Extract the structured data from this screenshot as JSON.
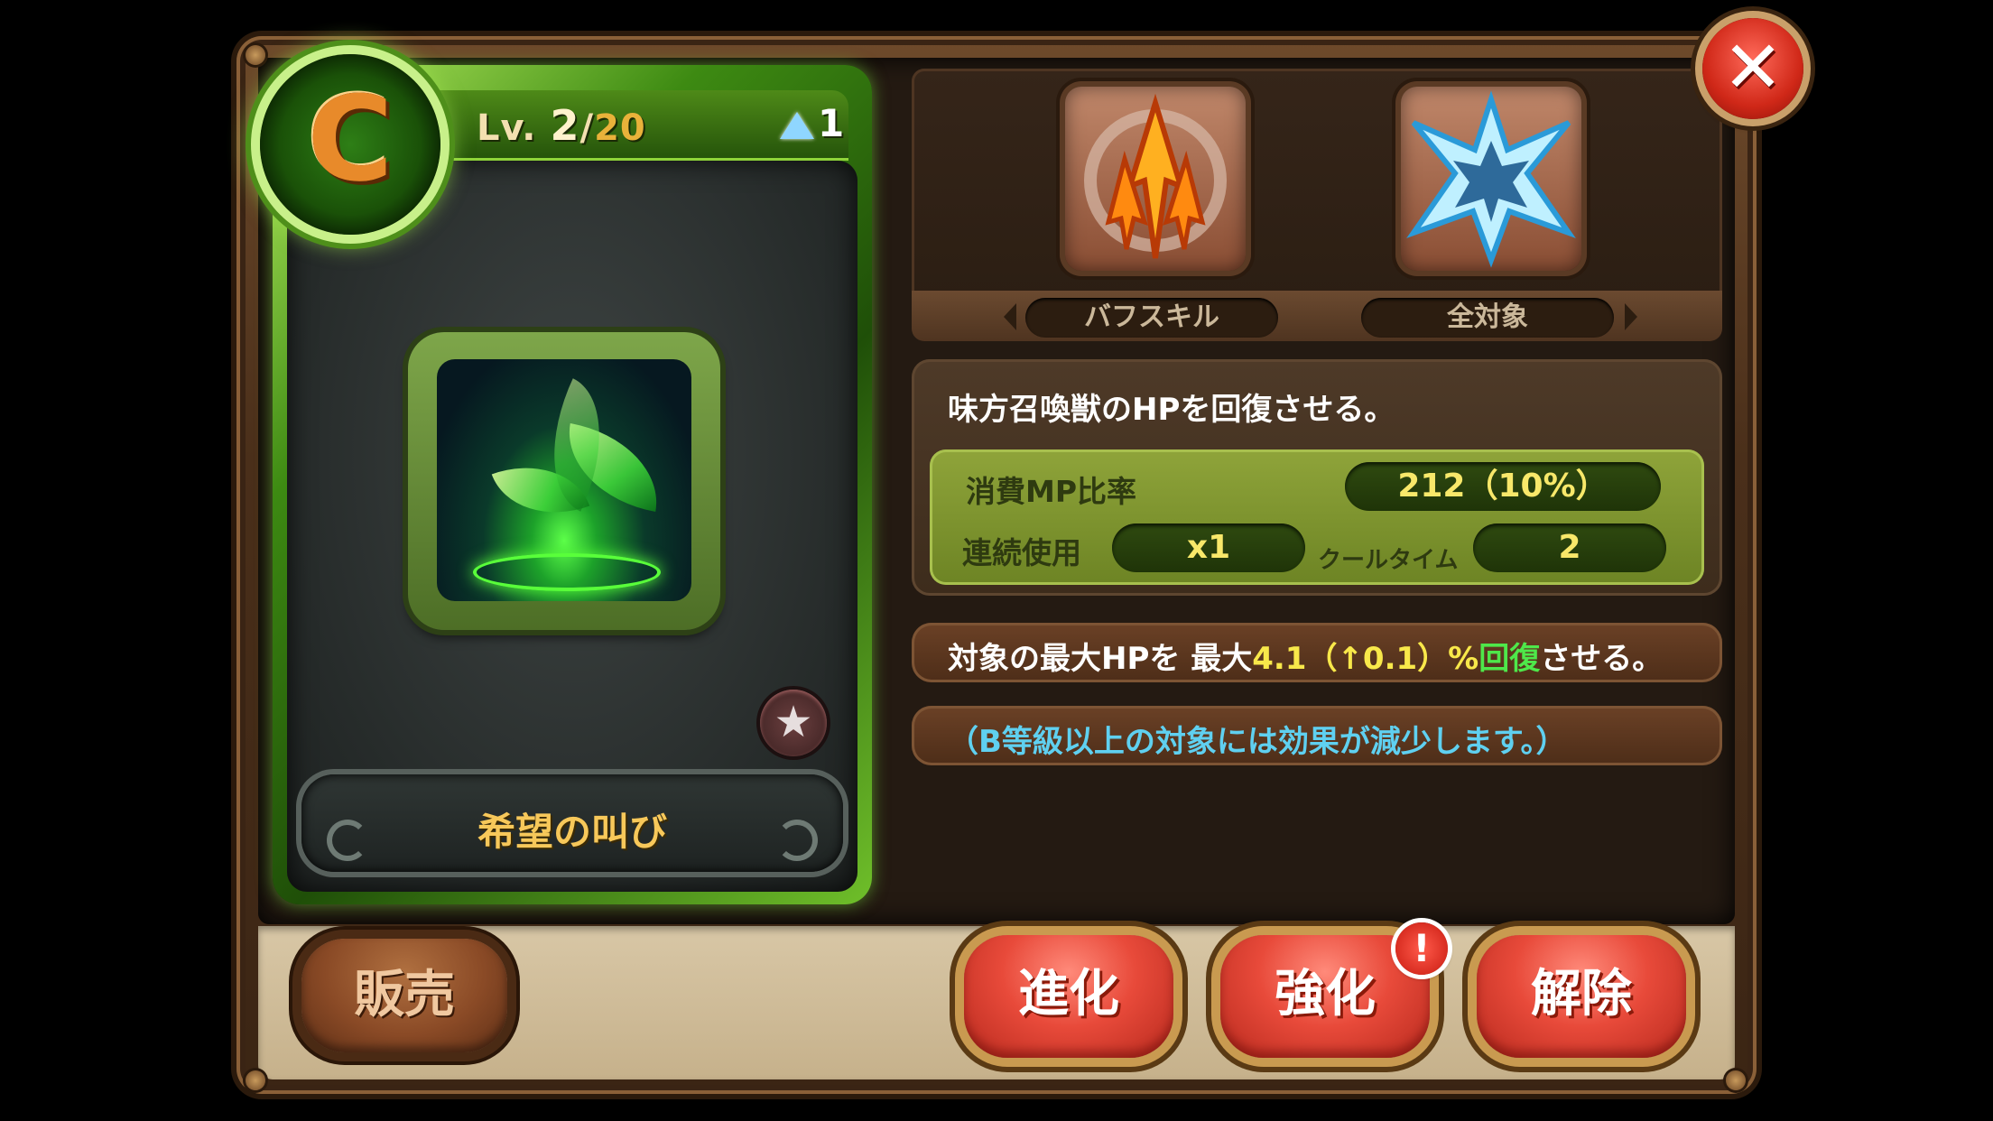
{
  "card": {
    "grade": "C",
    "level_prefix": "Lv.",
    "level_current": "2",
    "level_separator": "/",
    "level_max": "20",
    "awakening_count": "1",
    "skill_name": "希望の叫び"
  },
  "skill_tabs": {
    "type_label": "バフスキル",
    "target_label": "全対象"
  },
  "description": {
    "summary": "味方召喚獣のHPを回復させる。",
    "mp_label": "消費MP比率",
    "mp_value": "212（10%）",
    "combo_label": "連続使用",
    "combo_value": "x1",
    "cooldown_label": "クールタイム",
    "cooldown_value": "2"
  },
  "effect": {
    "prefix": "対象の最大HPを 最大",
    "amount": "4.1（↑0.1）",
    "percent": "%",
    "heal_word": "回復",
    "suffix": "させる。",
    "note": "（B等級以上の対象には効果が減少します。）"
  },
  "buttons": {
    "sell": "販売",
    "evolve": "進化",
    "enhance": "強化",
    "release": "解除",
    "alert": "!",
    "close": "✕",
    "favorite": "★"
  },
  "colors": {
    "card_green": "#3d8a12",
    "accent_red": "#e84a3a",
    "value_yellow": "#f8e84a",
    "heal_green": "#4ee84a",
    "note_blue": "#5fd0f0"
  }
}
